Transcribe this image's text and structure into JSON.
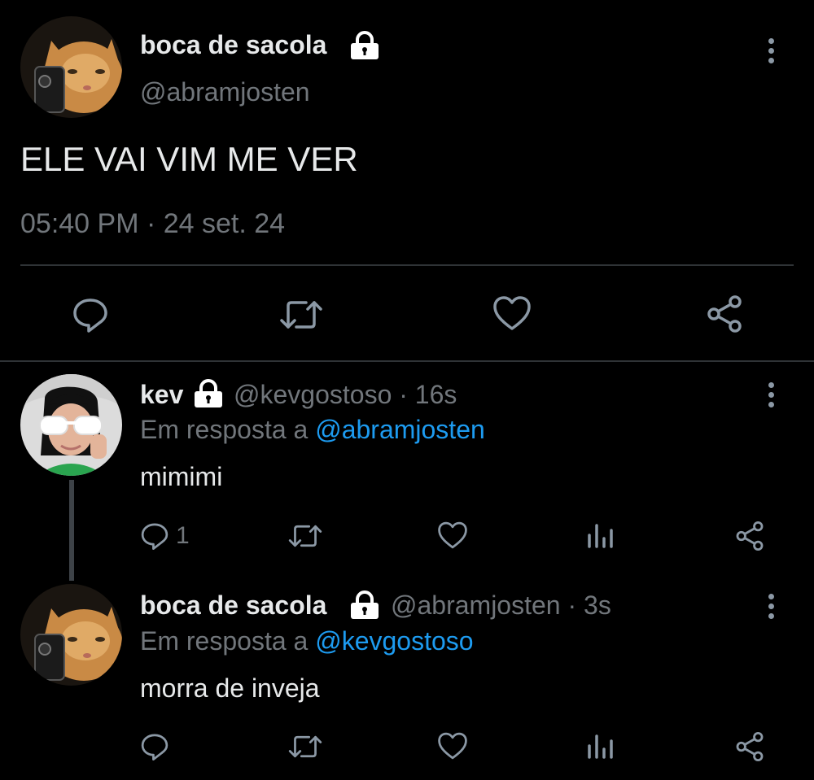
{
  "main_tweet": {
    "author_name": "boca de sacola",
    "handle": "@abramjosten",
    "text": "ELE VAI VIM ME VER",
    "timestamp": "05:40 PM · 24 set. 24",
    "lock_icon": "lock-icon",
    "actions": [
      "reply-icon",
      "retweet-icon",
      "like-icon",
      "share-icon"
    ]
  },
  "replies": [
    {
      "author_name": "kev",
      "handle_time": "@kevgostoso · 16s",
      "reply_prefix": "Em resposta a",
      "reply_to": "@abramjosten",
      "text": "mimimi",
      "reply_count": "1"
    },
    {
      "author_name": "boca de sacola",
      "handle_time": "@abramjosten · 3s",
      "reply_prefix": "Em resposta a",
      "reply_to": "@kevgostoso",
      "text": "morra de inveja",
      "reply_count": ""
    }
  ],
  "colors": {
    "background": "#000000",
    "text": "#e7e9ea",
    "muted": "#71767b",
    "accent": "#1d9bf0",
    "divider": "#2f3336"
  }
}
